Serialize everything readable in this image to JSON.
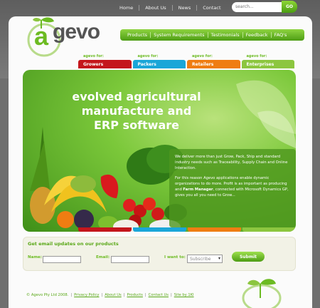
{
  "top_nav": [
    "Home",
    "About Us",
    "News",
    "Contact"
  ],
  "search": {
    "placeholder": "search...",
    "go_label": "GO"
  },
  "sub_nav": [
    "Products",
    "System Requirements",
    "Testimonials",
    "Feedback",
    "FAQ's"
  ],
  "logo": {
    "a": "a",
    "rest": "gevo"
  },
  "categories": [
    {
      "small": "agevo for:",
      "label": "Growers",
      "color": "#c4161c"
    },
    {
      "small": "agevo for:",
      "label": "Packers",
      "color": "#1aa6d8"
    },
    {
      "small": "agevo for:",
      "label": "Retailers",
      "color": "#ef7d12"
    },
    {
      "small": "agevo for:",
      "label": "Enterprises",
      "color": "#8cc63f"
    }
  ],
  "hero": {
    "title_line1": "evolved agricultural",
    "title_line2": "manufacture and",
    "title_line3": "ERP software",
    "p1": "We deliver more than just Grow, Pack, Ship and standard industry needs such as Traceability, Supply Chain and Online Interaction.",
    "p2_a": "For this reason Agevo applications enable dynamic organizations to do more. Profit is as important as producing and ",
    "p2_bold": "Farm Manager",
    "p2_b": ", connected with Microsoft Dynamics GP, gives you all you need to Grow..."
  },
  "newsletter": {
    "heading": "Get email updates on our products",
    "name_label": "Name:",
    "email_label": "Email:",
    "want_label": "I want to:",
    "select_value": "Subscribe",
    "submit_label": "Submit"
  },
  "footer": {
    "copyright": "© Agevo Pty Ltd 2008.",
    "links": [
      "Privacy Policy",
      "About Us",
      "Products",
      "Contact Us",
      "Site by 1KI"
    ]
  }
}
